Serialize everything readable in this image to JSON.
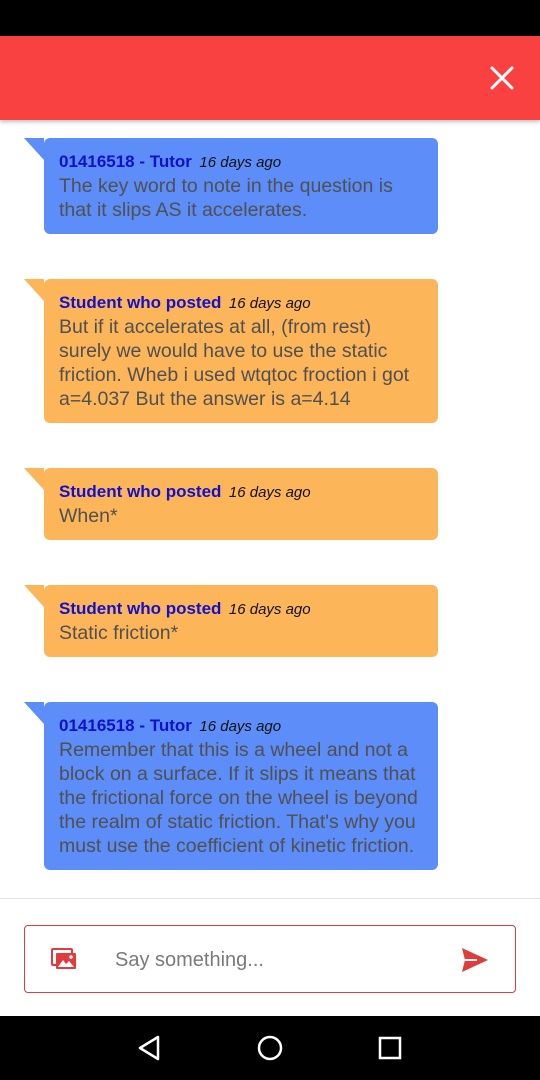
{
  "header": {
    "background": "#f94141",
    "close_icon": "close-icon"
  },
  "messages": [
    {
      "role": "tutor",
      "author": "01416518 - Tutor",
      "time": "16 days ago",
      "text": "The key word to note in the question is that it slips AS it accelerates."
    },
    {
      "role": "student",
      "author": "Student who posted",
      "time": "16 days ago",
      "text": "But if it accelerates at all, (from rest) surely we would have to use the static friction. Wheb i used wtqtoc froction i got a=4.037 But the answer is a=4.14"
    },
    {
      "role": "student",
      "author": "Student who posted",
      "time": "16 days ago",
      "text": "When*"
    },
    {
      "role": "student",
      "author": "Student who posted",
      "time": "16 days ago",
      "text": "Static friction*"
    },
    {
      "role": "tutor",
      "author": "01416518 - Tutor",
      "time": "16 days ago",
      "text": "Remember that this is a wheel and not a block on a surface. If it slips it means that the frictional force on the wheel is beyond the realm of static friction. That's why you must use the coefficient of kinetic friction."
    }
  ],
  "colors": {
    "tutor_bubble": "#5c8df8",
    "student_bubble": "#fdb55a",
    "author": "#1111cc",
    "accent": "#e23b3b"
  },
  "composer": {
    "placeholder": "Say something...",
    "value": "",
    "image_icon": "image-icon",
    "send_icon": "send-icon"
  },
  "navigation": {
    "back_icon": "back-triangle-icon",
    "home_icon": "home-circle-icon",
    "recents_icon": "recents-square-icon"
  }
}
